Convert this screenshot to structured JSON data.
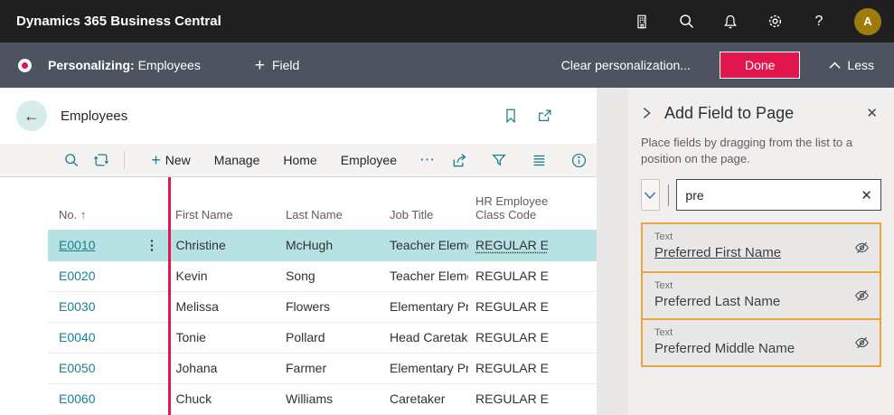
{
  "app_header": {
    "title": "Dynamics 365 Business Central",
    "help_label": "?",
    "avatar_initial": "A"
  },
  "personalization_bar": {
    "mode_label": "Personalizing:",
    "context": "Employees",
    "add_field_label": "Field",
    "clear_label": "Clear personalization...",
    "done_label": "Done",
    "less_label": "Less"
  },
  "page": {
    "title": "Employees"
  },
  "toolbar": {
    "items": [
      "New",
      "Manage",
      "Home",
      "Employee"
    ]
  },
  "table": {
    "columns": {
      "no": "No.",
      "sort_arrow": "↑",
      "first": "First Name",
      "last": "Last Name",
      "job": "Job Title",
      "hr_line1": "HR Employee",
      "hr_line2": "Class Code"
    },
    "rows": [
      {
        "no": "E0010",
        "first": "Christine",
        "last": "McHugh",
        "job": "Teacher Element...",
        "hr": "REGULAR E",
        "selected": true
      },
      {
        "no": "E0020",
        "first": "Kevin",
        "last": "Song",
        "job": "Teacher Element...",
        "hr": "REGULAR E"
      },
      {
        "no": "E0030",
        "first": "Melissa",
        "last": "Flowers",
        "job": "Elementary Prin...",
        "hr": "REGULAR E"
      },
      {
        "no": "E0040",
        "first": "Tonie",
        "last": "Pollard",
        "job": "Head Caretaker",
        "hr": "REGULAR E"
      },
      {
        "no": "E0050",
        "first": "Johana",
        "last": "Farmer",
        "job": "Elementary Prin...",
        "hr": "REGULAR E"
      },
      {
        "no": "E0060",
        "first": "Chuck",
        "last": "Williams",
        "job": "Caretaker",
        "hr": "REGULAR E"
      }
    ]
  },
  "panel": {
    "title": "Add Field to Page",
    "description": "Place fields by dragging from the list to a position on the page.",
    "search_value": "pre",
    "fields": [
      {
        "type": "Text",
        "name": "Preferred First Name"
      },
      {
        "type": "Text",
        "name": "Preferred Last Name"
      },
      {
        "type": "Text",
        "name": "Preferred Middle Name"
      }
    ]
  },
  "icons": {
    "plus": "+",
    "ellipsis": "⋯",
    "more_vertical": "⋮",
    "back_arrow": "←",
    "close": "✕"
  },
  "colors": {
    "topbar": "#1F1F1F",
    "personalization_bar": "#4D5460",
    "brand_crimson": "#E0164E",
    "accent_teal": "#1B7F8C",
    "selected_row": "#B7E2E3",
    "highlight_orange": "#ECA53C",
    "avatar_gold": "#9D7B0D"
  }
}
